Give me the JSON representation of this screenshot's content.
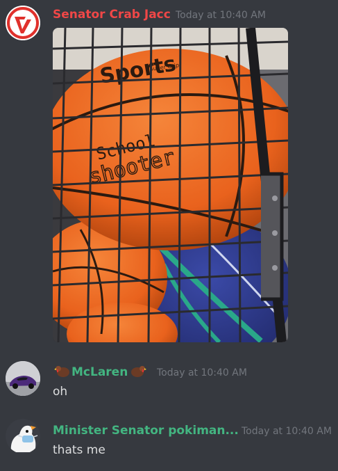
{
  "messages": [
    {
      "author": "Senator Crab Jacc",
      "author_color": "#f04747",
      "timestamp": "Today at 10:40 AM",
      "avatar": "red-circle-logo-icon",
      "attachment": {
        "type": "image",
        "printed_text": [
          "Sports",
          "School",
          "shooter",
          "Super Grip"
        ],
        "colors": {
          "ball": "#ee6a25",
          "ball_dark": "#b4460f",
          "grid": "#2a2a2e",
          "blue_ball": "#2f3a8c",
          "teal_stripe": "#2aa889"
        }
      }
    },
    {
      "author": "McLaren",
      "author_color": "#43b581",
      "timestamp": "Today at 10:40 AM",
      "avatar": "purple-car-avatar",
      "decorations": [
        "turkey-icon",
        "turkey-icon"
      ],
      "text": "oh"
    },
    {
      "author": "Minister Senator pokiman...",
      "author_color": "#43b581",
      "timestamp": "Today at 10:40 AM",
      "avatar": "goose-mask-avatar",
      "text": "thats me"
    }
  ]
}
